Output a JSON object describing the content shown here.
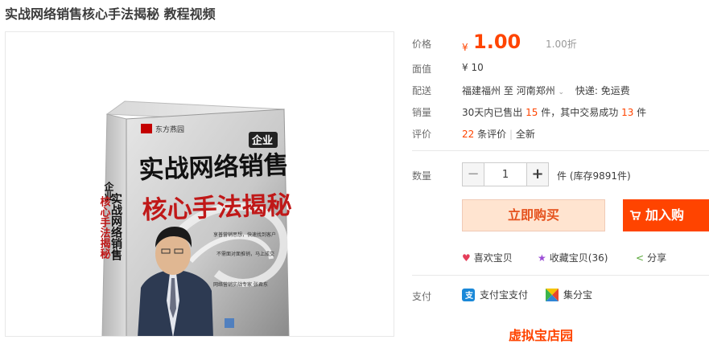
{
  "product": {
    "title": "实战网络销售核心手法揭秘 教程视频"
  },
  "cover": {
    "series_text": "东方燕园",
    "badge": "企业",
    "title_line1": "实战网络销售",
    "title_line2": "核心手法揭秘",
    "spine_top": "企业",
    "spine_title": "实战网络销售",
    "spine_sub": "核心手法揭秘",
    "slogan1": "享普营销思想，快速找到客户",
    "slogan2": "不需面对面推销，马上成交",
    "author_line": "网络营销实战专家 张君东"
  },
  "price": {
    "label": "价格",
    "currency": "¥",
    "value": "1.00",
    "discount": "1.00折"
  },
  "face_value": {
    "label": "面值",
    "value": "¥ 10"
  },
  "shipping": {
    "label": "配送",
    "from": "福建福州",
    "to_word": "至",
    "to": "河南郑州",
    "express": "快递: 免运费"
  },
  "sales": {
    "label": "销量",
    "prefix": "30天内已售出",
    "sold": "15",
    "mid": "件，其中交易成功",
    "success": "13",
    "suffix": "件"
  },
  "reviews": {
    "label": "评价",
    "count": "22",
    "count_suffix": "条评价",
    "sep": "|",
    "new_label": "全新"
  },
  "quantity": {
    "label": "数量",
    "value": "1",
    "minus": "−",
    "plus": "+",
    "stock_text": "件 (库存9891件)"
  },
  "buttons": {
    "buy_now": "立即购买",
    "add_cart": "加入购"
  },
  "actions": {
    "like": "喜欢宝贝",
    "favorite": "收藏宝贝(36)",
    "share": "分享"
  },
  "payment": {
    "label": "支付",
    "alipay": "支付宝支付",
    "jifen": "集分宝"
  },
  "shop": {
    "link": "虚拟宝店园"
  },
  "colors": {
    "accent": "#ff4400",
    "buy_bg": "#ffe4d0",
    "price": "#ff4400"
  }
}
